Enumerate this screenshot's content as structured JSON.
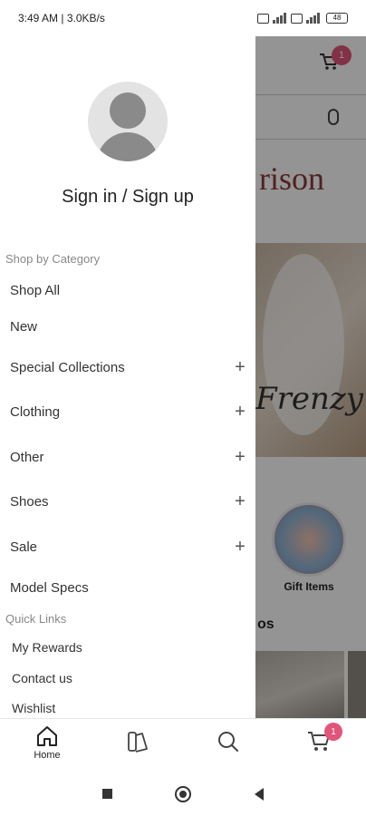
{
  "status_bar": {
    "time_speed": "3:49 AM | 3.0KB/s",
    "battery": "48"
  },
  "background": {
    "cart_badge": "1",
    "brand_partial": "rison",
    "banner_script": "Frenzy",
    "gift_label": "Gift Items",
    "heading_partial": "os"
  },
  "drawer": {
    "sign_in": "Sign in / Sign up",
    "shop_by_category": "Shop by Category",
    "categories": [
      {
        "label": "Shop All"
      },
      {
        "label": "New"
      },
      {
        "label": "Special Collections",
        "expand": "+"
      },
      {
        "label": "Clothing",
        "expand": "+"
      },
      {
        "label": "Other",
        "expand": "+"
      },
      {
        "label": "Shoes",
        "expand": "+"
      },
      {
        "label": "Sale",
        "expand": "+"
      },
      {
        "label": "Model Specs"
      }
    ],
    "quick_links_title": "Quick Links",
    "quick_links": [
      "My Rewards",
      "Contact us",
      "Wishlist"
    ]
  },
  "bottom_nav": {
    "home_label": "Home",
    "cart_badge": "1"
  }
}
